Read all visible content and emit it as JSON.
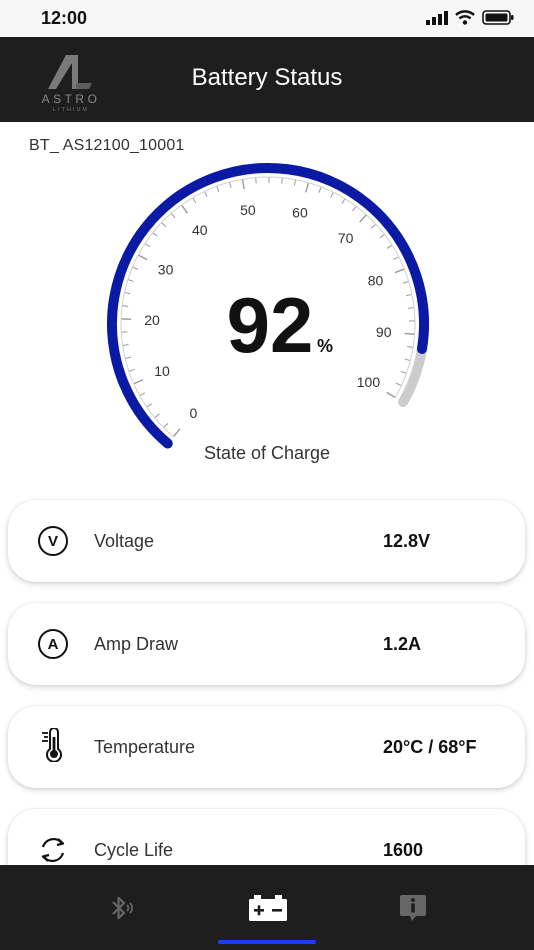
{
  "status_bar": {
    "time": "12:00"
  },
  "header": {
    "title": "Battery Status",
    "logo": {
      "brand": "ASTRO",
      "sub": "LITHIUM"
    }
  },
  "device": {
    "id": "BT_ AS12100_10001"
  },
  "gauge": {
    "value": "92",
    "unit": "%",
    "label": "State of Charge",
    "level_fraction": 0.92,
    "ticks": [
      "0",
      "10",
      "20",
      "30",
      "40",
      "50",
      "60",
      "70",
      "80",
      "90",
      "100"
    ],
    "colors": {
      "fill": "#0a1aa5",
      "track": "#cccccc"
    }
  },
  "metrics": [
    {
      "label": "Voltage",
      "value": "12.8V",
      "icon": "voltage-icon",
      "glyph": "V"
    },
    {
      "label": "Amp Draw",
      "value": "1.2A",
      "icon": "amp-icon",
      "glyph": "A"
    },
    {
      "label": "Temperature",
      "value": "20°C / 68°F",
      "icon": "thermometer-icon"
    },
    {
      "label": "Cycle Life",
      "value": "1600",
      "icon": "cycle-icon"
    }
  ],
  "nav": {
    "items": [
      {
        "icon": "bluetooth-icon",
        "active": false
      },
      {
        "icon": "battery-icon",
        "active": true
      },
      {
        "icon": "info-icon",
        "active": false
      }
    ],
    "indicator_color": "#1a3cff"
  }
}
